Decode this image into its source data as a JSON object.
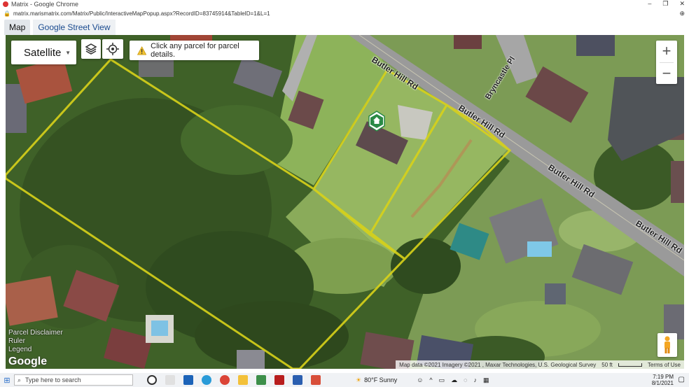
{
  "window": {
    "title": "Matrix - Google Chrome",
    "url": "matrix.marismatrix.com/Matrix/Public/InteractiveMapPopup.aspx?RecordID=83745914&TableID=1&L=1"
  },
  "tabs": [
    {
      "label": "Map",
      "active": true
    },
    {
      "label": "Google Street View",
      "active": false
    }
  ],
  "map": {
    "type_selector": "Satellite",
    "notice": "Click any parcel for parcel details.",
    "road_labels": [
      "Butler Hill Rd",
      "Butler Hill Rd",
      "Butler Hill Rd",
      "Butler Hill Rd",
      "Bryncastle Pl"
    ],
    "links": {
      "parcel_disclaimer": "Parcel Disclaimer",
      "ruler": "Ruler",
      "legend": "Legend"
    },
    "google_logo": "Google",
    "attribution": {
      "map_data": "Map data ©2021 Imagery ©2021 , Maxar Technologies, U.S. Geological Survey",
      "scale": "50 ft",
      "terms": "Terms of Use"
    },
    "colors": {
      "parcel_outline": "#d8d21a",
      "road": "#9a9a9a",
      "grass": "#7aa04a",
      "trees": "#3b5a26"
    }
  },
  "taskbar": {
    "search_placeholder": "Type here to search",
    "weather": "80°F  Sunny",
    "time": "7:19 PM",
    "date": "8/1/2021"
  }
}
